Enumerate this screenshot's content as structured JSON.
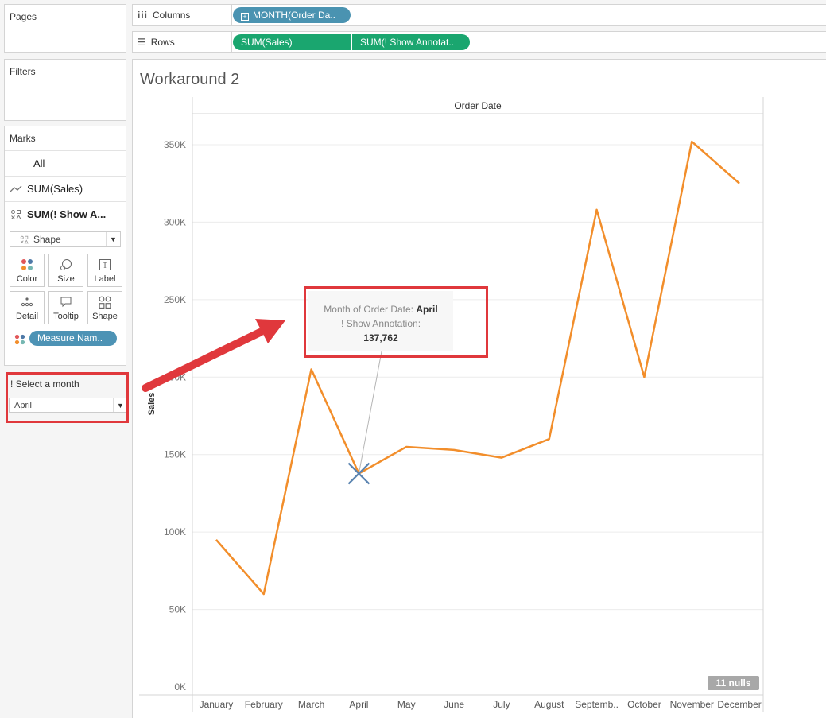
{
  "sidebar": {
    "pages_title": "Pages",
    "filters_title": "Filters",
    "marks_title": "Marks",
    "marks_rows": [
      {
        "label": "All"
      },
      {
        "label": "SUM(Sales)"
      },
      {
        "label": "SUM(! Show A..."
      }
    ],
    "mark_type": "Shape",
    "mark_buttons": [
      "Color",
      "Size",
      "Label",
      "Detail",
      "Tooltip",
      "Shape"
    ],
    "measure_pill": "Measure Nam..",
    "parameter": {
      "title": "! Select a month",
      "value": "April"
    }
  },
  "shelves": {
    "columns_label": "Columns",
    "columns_pill": "MONTH(Order Da..",
    "rows_label": "Rows",
    "rows_pills": [
      "SUM(Sales)",
      "SUM(! Show Annotat.."
    ]
  },
  "view": {
    "title": "Workaround 2",
    "nulls_badge": "11 nulls"
  },
  "tooltip": {
    "line1_label": "Month of Order Date:",
    "line1_value": "April",
    "line2_label": "! Show Annotation:",
    "line3_value": "137,762"
  },
  "colors": {
    "line": "#f28e2b",
    "marker": "#5b84b1",
    "pill_green": "#1aa66f",
    "pill_blue": "#4a93b1",
    "highlight": "#e0383c"
  },
  "chart_data": {
    "type": "line",
    "title": "Workaround 2",
    "xlabel": "Order Date",
    "ylabel": "Sales",
    "categories": [
      "January",
      "February",
      "March",
      "April",
      "May",
      "June",
      "July",
      "August",
      "Septemb..",
      "October",
      "November",
      "December"
    ],
    "series": [
      {
        "values": [
          95000,
          60000,
          205000,
          137762,
          155000,
          153000,
          148000,
          160000,
          308000,
          200000,
          352000,
          325000
        ]
      }
    ],
    "annotation": {
      "category": "April",
      "value": 137762
    },
    "yticks": [
      0,
      50000,
      100000,
      150000,
      200000,
      250000,
      300000,
      350000
    ],
    "ytick_labels": [
      "0K",
      "50K",
      "100K",
      "150K",
      "200K",
      "250K",
      "300K",
      "350K"
    ],
    "ylim": [
      0,
      370000
    ],
    "grid": true
  }
}
